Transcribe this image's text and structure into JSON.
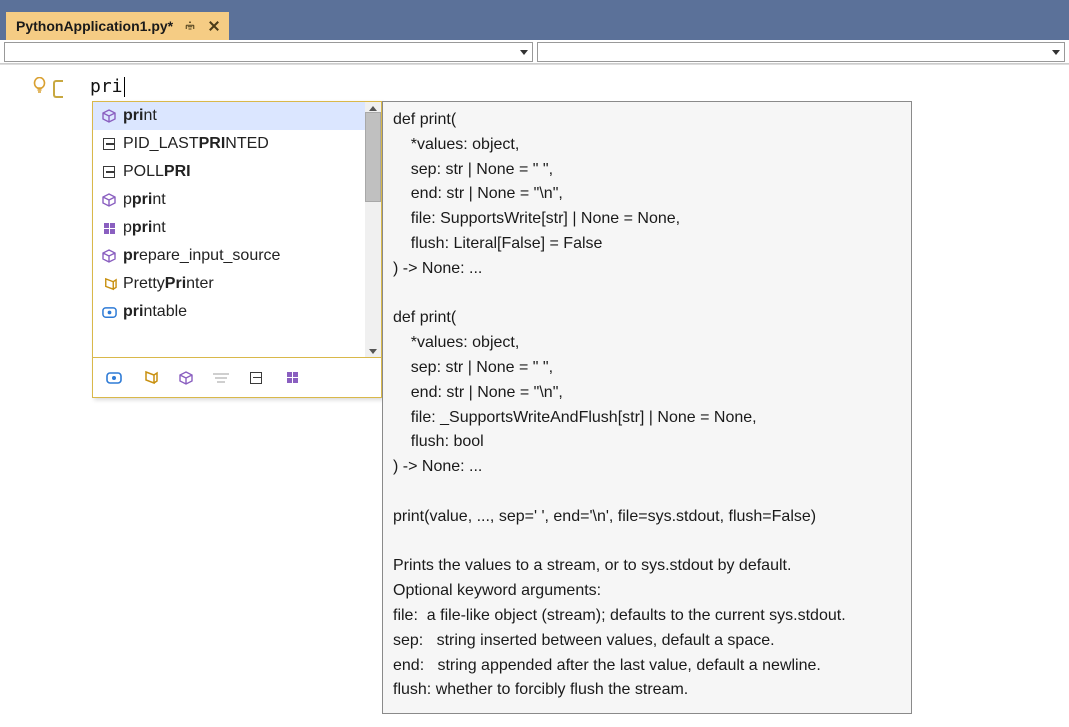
{
  "tab": {
    "title": "PythonApplication1.py*"
  },
  "editor": {
    "typed_text": "pri"
  },
  "intellisense": {
    "items": [
      {
        "icon": "cube",
        "pre": "",
        "bold": "pri",
        "post": "nt"
      },
      {
        "icon": "const",
        "pre": "PID_LAST",
        "bold": "PRI",
        "post": "NTED"
      },
      {
        "icon": "const",
        "pre": "POLL",
        "bold": "PRI",
        "post": ""
      },
      {
        "icon": "cube",
        "pre": "p",
        "bold": "pri",
        "post": "nt"
      },
      {
        "icon": "module",
        "pre": "p",
        "bold": "pri",
        "post": "nt"
      },
      {
        "icon": "cube",
        "pre": "",
        "bold": "pr",
        "post": "epare_input_source"
      },
      {
        "icon": "class-yellow",
        "pre": "Pretty",
        "bold": "Pri",
        "post": "nter"
      },
      {
        "icon": "interface",
        "pre": "",
        "bold": "pri",
        "post": "ntable"
      }
    ]
  },
  "tooltip_text": "def print(\n    *values: object,\n    sep: str | None = \" \",\n    end: str | None = \"\\n\",\n    file: SupportsWrite[str] | None = None,\n    flush: Literal[False] = False\n) -> None: ...\n\ndef print(\n    *values: object,\n    sep: str | None = \" \",\n    end: str | None = \"\\n\",\n    file: _SupportsWriteAndFlush[str] | None = None,\n    flush: bool\n) -> None: ...\n\nprint(value, ..., sep=' ', end='\\n', file=sys.stdout, flush=False)\n\nPrints the values to a stream, or to sys.stdout by default.\nOptional keyword arguments:\nfile:  a file-like object (stream); defaults to the current sys.stdout.\nsep:   string inserted between values, default a space.\nend:   string appended after the last value, default a newline.\nflush: whether to forcibly flush the stream."
}
